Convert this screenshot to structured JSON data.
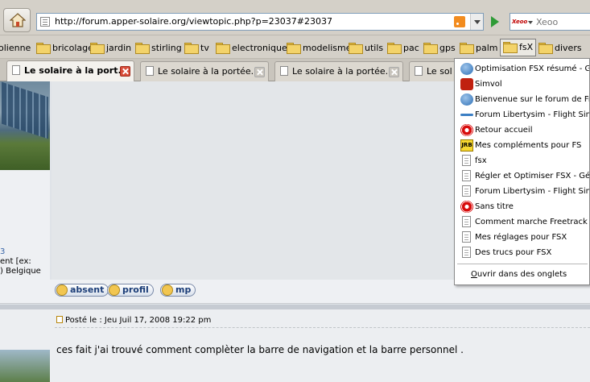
{
  "navbar": {
    "url": "http://forum.apper-solaire.org/viewtopic.php?p=23037#23037",
    "search_engine": "Xeoo",
    "search_placeholder": "Xeoo"
  },
  "bookmarks": [
    {
      "label": "olienne"
    },
    {
      "label": "bricolage"
    },
    {
      "label": "jardin"
    },
    {
      "label": "stirling"
    },
    {
      "label": "tv"
    },
    {
      "label": "electronique"
    },
    {
      "label": "modelisme"
    },
    {
      "label": "utils"
    },
    {
      "label": "pac"
    },
    {
      "label": "gps"
    },
    {
      "label": "palm"
    },
    {
      "label": "fsX"
    },
    {
      "label": "divers"
    }
  ],
  "tabs": [
    {
      "label": "Le solaire à la port...",
      "active": true
    },
    {
      "label": "Le solaire à la portée...",
      "active": false
    },
    {
      "label": "Le solaire à la portée...",
      "active": false
    },
    {
      "label": "Le sol",
      "active": false
    }
  ],
  "menu": {
    "items": [
      {
        "label": "Optimisation FSX résumé - Géné",
        "icon": "globe-icon"
      },
      {
        "label": "Simvol",
        "icon": "simvol-icon"
      },
      {
        "label": "Bienvenue sur le forum de Fran",
        "icon": "globe-icon"
      },
      {
        "label": "Forum Libertysim - Flight Simul",
        "icon": "plane-icon"
      },
      {
        "label": "Retour accueil",
        "icon": "red-target-icon"
      },
      {
        "label": "Mes compléments pour FS",
        "icon": "jrb-icon"
      },
      {
        "label": "fsx",
        "icon": "page-icon"
      },
      {
        "label": "Régler et Optimiser FSX - Géné",
        "icon": "page-icon"
      },
      {
        "label": "Forum Libertysim - Flight Simul",
        "icon": "page-icon"
      },
      {
        "label": "Sans titre",
        "icon": "red-target-icon"
      },
      {
        "label": "Comment marche Freetrack ?",
        "icon": "page-icon"
      },
      {
        "label": "Mes réglages pour FSX",
        "icon": "page-icon"
      },
      {
        "label": "Des trucs pour FSX",
        "icon": "page-icon"
      }
    ],
    "open_all_prefix": "",
    "open_all_accesskey": "O",
    "open_all_rest": "uvrir dans des onglets"
  },
  "post1": {
    "user_meta_line1": "3",
    "user_meta_line2": "ent [ex:",
    "user_meta_line3": ") Belgique",
    "buttons": {
      "absent": "absent",
      "profil": "profil",
      "mp": "mp"
    }
  },
  "post2": {
    "meta": "Posté le : Jeu Juil 17, 2008 19:22 pm",
    "text": "ces fait j'ai trouvé comment complèter la barre de navigation et la barre personnel ."
  }
}
